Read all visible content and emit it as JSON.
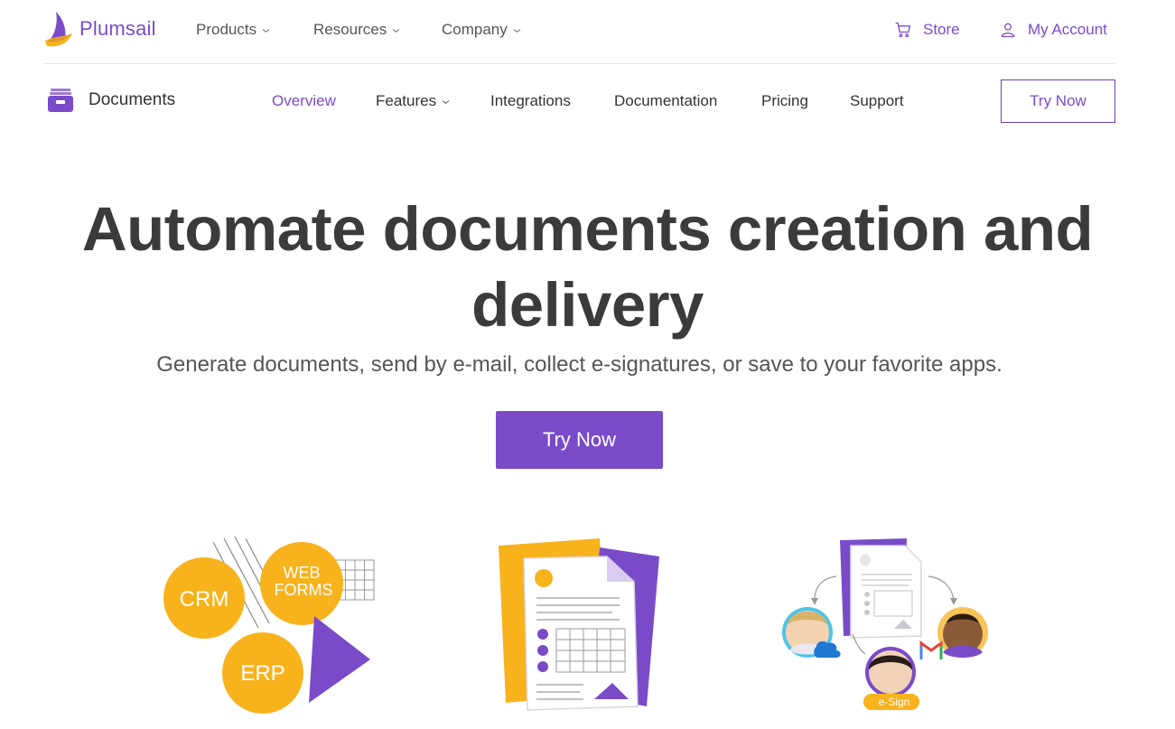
{
  "brand": {
    "name": "Plumsail",
    "accent": "#7a4bc9",
    "orange": "#f7b21c"
  },
  "top_nav": {
    "items": [
      {
        "label": "Products",
        "dropdown": true
      },
      {
        "label": "Resources",
        "dropdown": true
      },
      {
        "label": "Company",
        "dropdown": true
      }
    ],
    "store": {
      "label": "Store",
      "icon": "cart-icon"
    },
    "account": {
      "label": "My Account",
      "icon": "user-icon"
    }
  },
  "sub_nav": {
    "product": {
      "name": "Documents",
      "icon": "archive-box-icon"
    },
    "items": [
      {
        "label": "Overview",
        "active": true
      },
      {
        "label": "Features",
        "dropdown": true
      },
      {
        "label": "Integrations"
      },
      {
        "label": "Documentation"
      },
      {
        "label": "Pricing"
      },
      {
        "label": "Support"
      }
    ],
    "cta_label": "Try Now"
  },
  "hero": {
    "title_line1": "Automate documents creation and",
    "title_line2": "delivery",
    "subtitle": "Generate documents, send by e-mail, collect e-signatures, or save to your favorite apps.",
    "cta_label": "Try Now"
  },
  "illustrations": {
    "sources": {
      "crm": "CRM",
      "web_forms_1": "WEB",
      "web_forms_2": "FORMS",
      "erp": "ERP"
    },
    "delivery": {
      "esign_label": "e-Sign"
    }
  }
}
